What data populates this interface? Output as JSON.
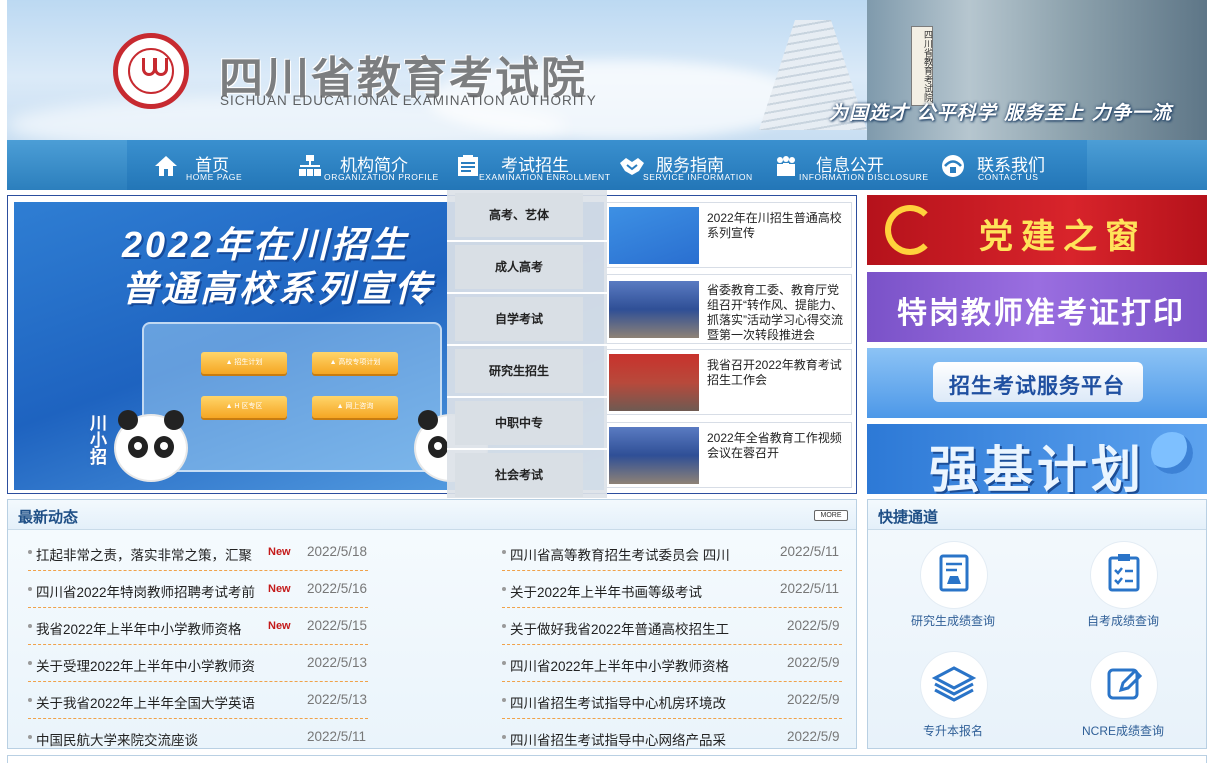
{
  "header": {
    "title": "四川省教育考试院",
    "subtitle": "SICHUAN EDUCATIONAL EXAMINATION AUTHORITY",
    "slogan": "为国选才 公平科学 服务至上 力争一流",
    "building_sign": "四川省教育考试院"
  },
  "nav": {
    "items": [
      {
        "cn": "首页",
        "en": "HOME PAGE",
        "icon": "home-icon"
      },
      {
        "cn": "机构简介",
        "en": "ORGANIZATION PROFILE",
        "icon": "org-chart-icon"
      },
      {
        "cn": "考试招生",
        "en": "EXAMINATION ENROLLMENT",
        "icon": "exam-icon"
      },
      {
        "cn": "服务指南",
        "en": "SERVICE INFORMATION",
        "icon": "handshake-icon"
      },
      {
        "cn": "信息公开",
        "en": "INFORMATION DISCLOSURE",
        "icon": "people-icon"
      },
      {
        "cn": "联系我们",
        "en": "CONTACT US",
        "icon": "contact-icon"
      }
    ]
  },
  "dropdown": {
    "items": [
      "高考、艺体",
      "成人高考",
      "自学考试",
      "研究生招生",
      "中职中专",
      "社会考试"
    ]
  },
  "slide": {
    "headline_line1": "2022年在川招生",
    "headline_line2": "普通高校系列宣传",
    "mascot_text": "川小招",
    "buttons": [
      "▲ 招生计划",
      "▲ 高校专项计划",
      "▲ H 区专区",
      "▲ 网上咨询"
    ]
  },
  "featured_news": [
    {
      "title": "2022年在川招生普通高校系列宣传"
    },
    {
      "title": "省委教育工委、教育厅党组召开“转作风、提能力、抓落实”活动学习心得交流暨第一次转段推进会"
    },
    {
      "title": "我省召开2022年教育考试招生工作会"
    },
    {
      "title": "2022年全省教育工作视频会议在蓉召开"
    }
  ],
  "ads": {
    "party": "党建之窗",
    "teacher": "特岗教师准考证打印",
    "platform": "招生考试服务平台",
    "strong": "强基计划"
  },
  "latest": {
    "heading": "最新动态",
    "more": "MORE",
    "new_tag": "New",
    "left": [
      {
        "title": "扛起非常之责，落实非常之策，汇聚",
        "date": "2022/5/18",
        "is_new": true
      },
      {
        "title": "四川省2022年特岗教师招聘考试考前",
        "date": "2022/5/16",
        "is_new": true
      },
      {
        "title": "我省2022年上半年中小学教师资格",
        "date": "2022/5/15",
        "is_new": true
      },
      {
        "title": "关于受理2022年上半年中小学教师资",
        "date": "2022/5/13",
        "is_new": false
      },
      {
        "title": "关于我省2022年上半年全国大学英语",
        "date": "2022/5/13",
        "is_new": false
      },
      {
        "title": "中国民航大学来院交流座谈",
        "date": "2022/5/11",
        "is_new": false
      }
    ],
    "right": [
      {
        "title": "四川省高等教育招生考试委员会 四川",
        "date": "2022/5/11"
      },
      {
        "title": "关于2022年上半年书画等级考试",
        "date": "2022/5/11"
      },
      {
        "title": "关于做好我省2022年普通高校招生工",
        "date": "2022/5/9"
      },
      {
        "title": "四川省2022年上半年中小学教师资格",
        "date": "2022/5/9"
      },
      {
        "title": "四川省招生考试指导中心机房环境改",
        "date": "2022/5/9"
      },
      {
        "title": "四川省招生考试指导中心网络产品采",
        "date": "2022/5/9"
      }
    ]
  },
  "quick": {
    "heading": "快捷通道",
    "items": [
      {
        "label": "研究生成绩查询",
        "icon": "report-icon"
      },
      {
        "label": "自考成绩查询",
        "icon": "clipboard-check-icon"
      },
      {
        "label": "专升本报名",
        "icon": "layers-icon"
      },
      {
        "label": "NCRE成绩查询",
        "icon": "edit-icon"
      }
    ]
  },
  "colors": {
    "nav_blue": "#2c7fbd",
    "heading_blue": "#1f4f86",
    "new_red": "#c41a1a",
    "dash_orange": "#f0a24a",
    "seal_red": "#c72a30"
  }
}
